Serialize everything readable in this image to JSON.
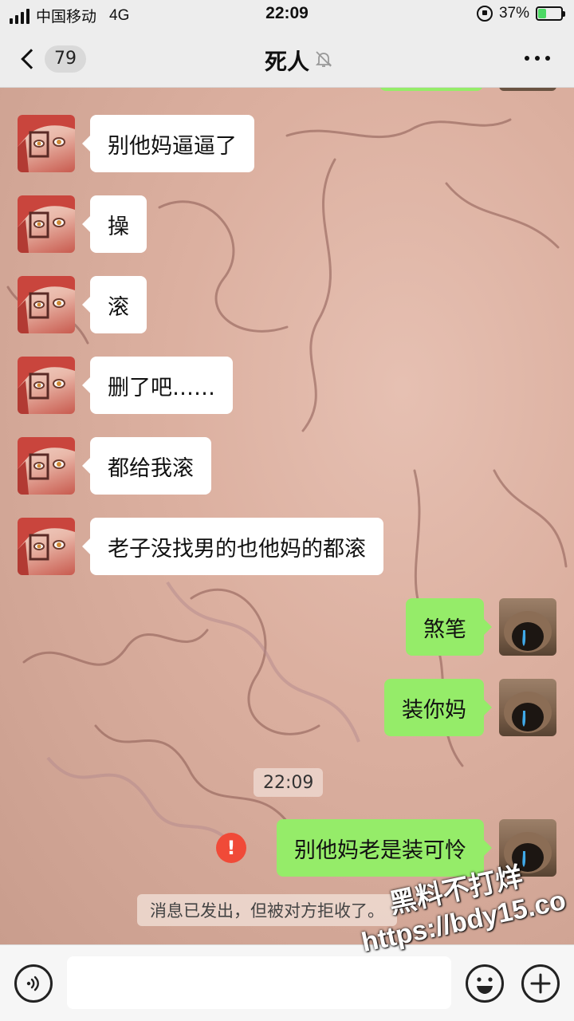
{
  "status_bar": {
    "carrier": "中国移动",
    "network": "4G",
    "time": "22:09",
    "battery_percent": "37%",
    "battery_level": 0.37
  },
  "nav": {
    "unread_count": "79",
    "title": "死人",
    "back_icon": "chevron-left-icon",
    "mute_icon": "bell-off-icon",
    "more_icon": "more-dots-icon"
  },
  "messages": [
    {
      "side": "in",
      "text": "别他妈逼逼了"
    },
    {
      "side": "in",
      "text": "操"
    },
    {
      "side": "in",
      "text": "滚"
    },
    {
      "side": "in",
      "text": "删了吧……"
    },
    {
      "side": "in",
      "text": "都给我滚"
    },
    {
      "side": "in",
      "text": "老子没找男的也他妈的都滚"
    },
    {
      "side": "out",
      "text": "煞笔"
    },
    {
      "side": "out",
      "text": "装你妈"
    },
    {
      "side": "out",
      "text": "别他妈老是装可怜",
      "status": "rejected"
    }
  ],
  "timestamp_divider": "22:09",
  "error_mark": "!",
  "system_notice": "消息已发出，但被对方拒收了。",
  "input": {
    "value": "",
    "placeholder": ""
  },
  "watermark": {
    "line1": "黑料不打烊",
    "line2": "https://bdy15.co"
  },
  "colors": {
    "outgoing_bubble": "#95ec69",
    "incoming_bubble": "#ffffff",
    "error": "#f04a38",
    "bar_background": "#ededed"
  }
}
